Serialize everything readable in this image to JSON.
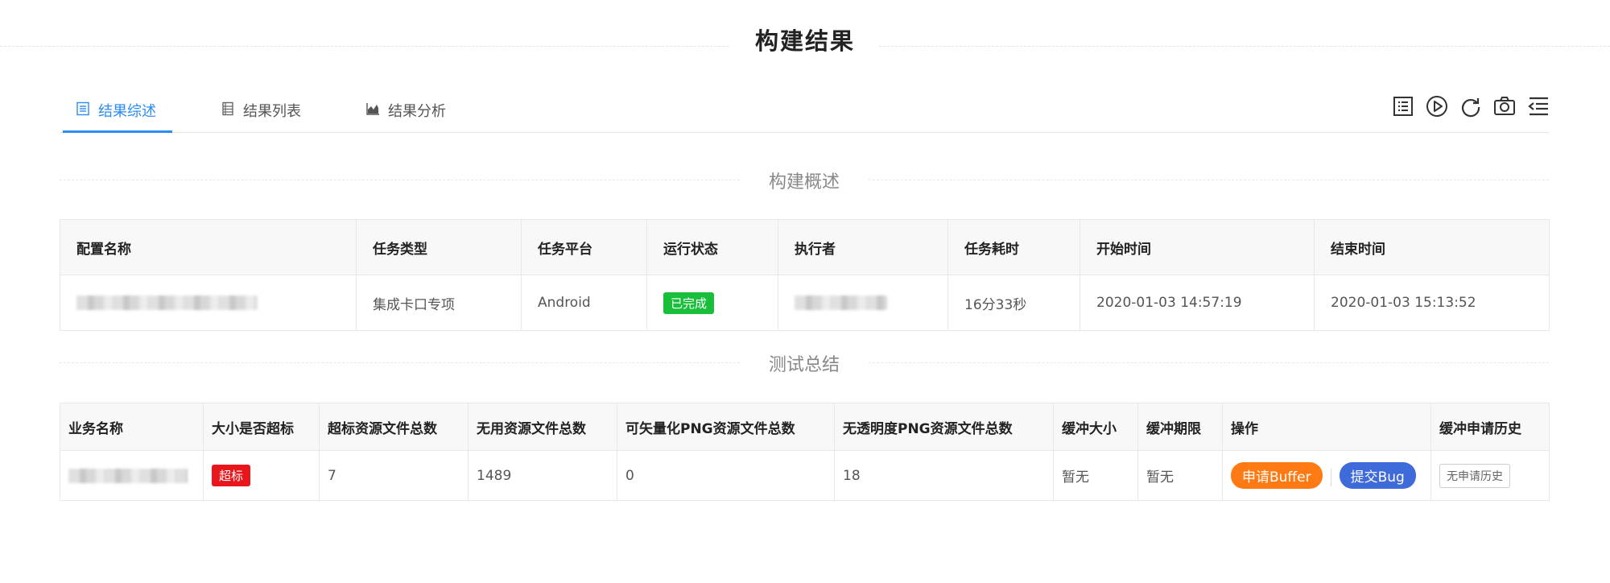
{
  "page": {
    "title": "构建结果"
  },
  "tabs": [
    {
      "label": "结果综述",
      "icon": "document-list-icon",
      "active": true
    },
    {
      "label": "结果列表",
      "icon": "list-icon",
      "active": false
    },
    {
      "label": "结果分析",
      "icon": "area-chart-icon",
      "active": false
    }
  ],
  "toolbar": [
    "report-icon",
    "play-icon",
    "refresh-icon",
    "camera-icon",
    "collapse-menu-icon"
  ],
  "overview": {
    "section_title": "构建概述",
    "headers": [
      "配置名称",
      "任务类型",
      "任务平台",
      "运行状态",
      "执行者",
      "任务耗时",
      "开始时间",
      "结束时间"
    ],
    "row": {
      "config_name": "",
      "task_type": "集成卡口专项",
      "platform": "Android",
      "status": "已完成",
      "executor": "",
      "duration": "16分33秒",
      "start_time": "2020-01-03 14:57:19",
      "end_time": "2020-01-03 15:13:52"
    },
    "status_color": "#19be3b"
  },
  "summary": {
    "section_title": "测试总结",
    "headers": [
      "业务名称",
      "大小是否超标",
      "超标资源文件总数",
      "无用资源文件总数",
      "可矢量化PNG资源文件总数",
      "无透明度PNG资源文件总数",
      "缓冲大小",
      "缓冲期限",
      "操作",
      "缓冲申请历史"
    ],
    "row": {
      "business_name": "",
      "over_limit": "超标",
      "over_limit_files": "7",
      "unused_files": "1489",
      "vectorizable_png": "0",
      "no_alpha_png": "18",
      "buffer_size": "暂无",
      "buffer_deadline": "暂无",
      "apply_buffer": "申请Buffer",
      "submit_bug": "提交Bug",
      "history": "无申请历史"
    },
    "colors": {
      "over_limit": "#e8151b",
      "apply_buffer": "#ff7a12",
      "submit_bug": "#3e6bd9"
    }
  }
}
